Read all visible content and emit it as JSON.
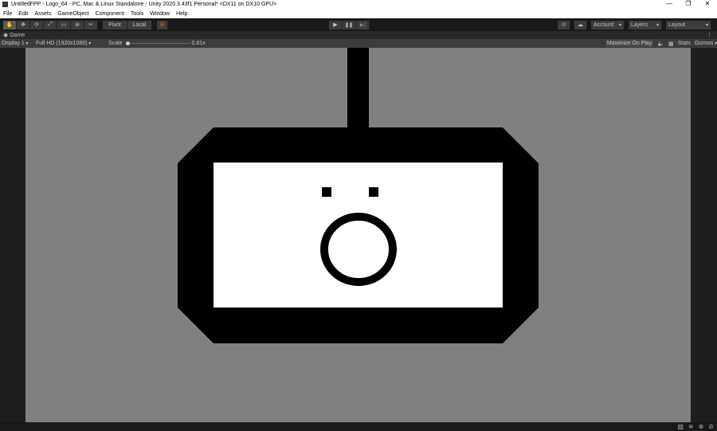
{
  "window": {
    "title": "UntitledFPP - Logo_64 - PC, Mac & Linux Standalone - Unity 2020.3.43f1 Personal* <DX11 on DX10 GPU>",
    "minimize": "—",
    "restore": "❐",
    "close": "✕"
  },
  "menu": [
    "File",
    "Edit",
    "Assets",
    "GameObject",
    "Component",
    "Tools",
    "Window",
    "Help"
  ],
  "toolbar": {
    "tools": [
      "✋",
      "✥",
      "⟳",
      "⤢",
      "▭",
      "⊛",
      "✂"
    ],
    "pivot": "Pivot",
    "local": "Local",
    "snap": "⊞",
    "play": "▶",
    "pause": "❚❚",
    "step": "▶|",
    "collab": "⊙",
    "cloud": "☁",
    "account": "Account",
    "layers": "Layers",
    "layout": "Layout"
  },
  "game": {
    "tab": "Game",
    "display": "Display 1",
    "resolution": "Full HD (1920x1080)",
    "scale_label": "Scale",
    "scale_value": "0.81x",
    "scale_fraction": 0.0,
    "maximize": "Maximize On Play",
    "stats": "Stats",
    "gizmos": "Gizmos",
    "more": "⋮"
  },
  "colors": {
    "background": "#808080",
    "logo": "#000000",
    "screen": "#ffffff"
  }
}
